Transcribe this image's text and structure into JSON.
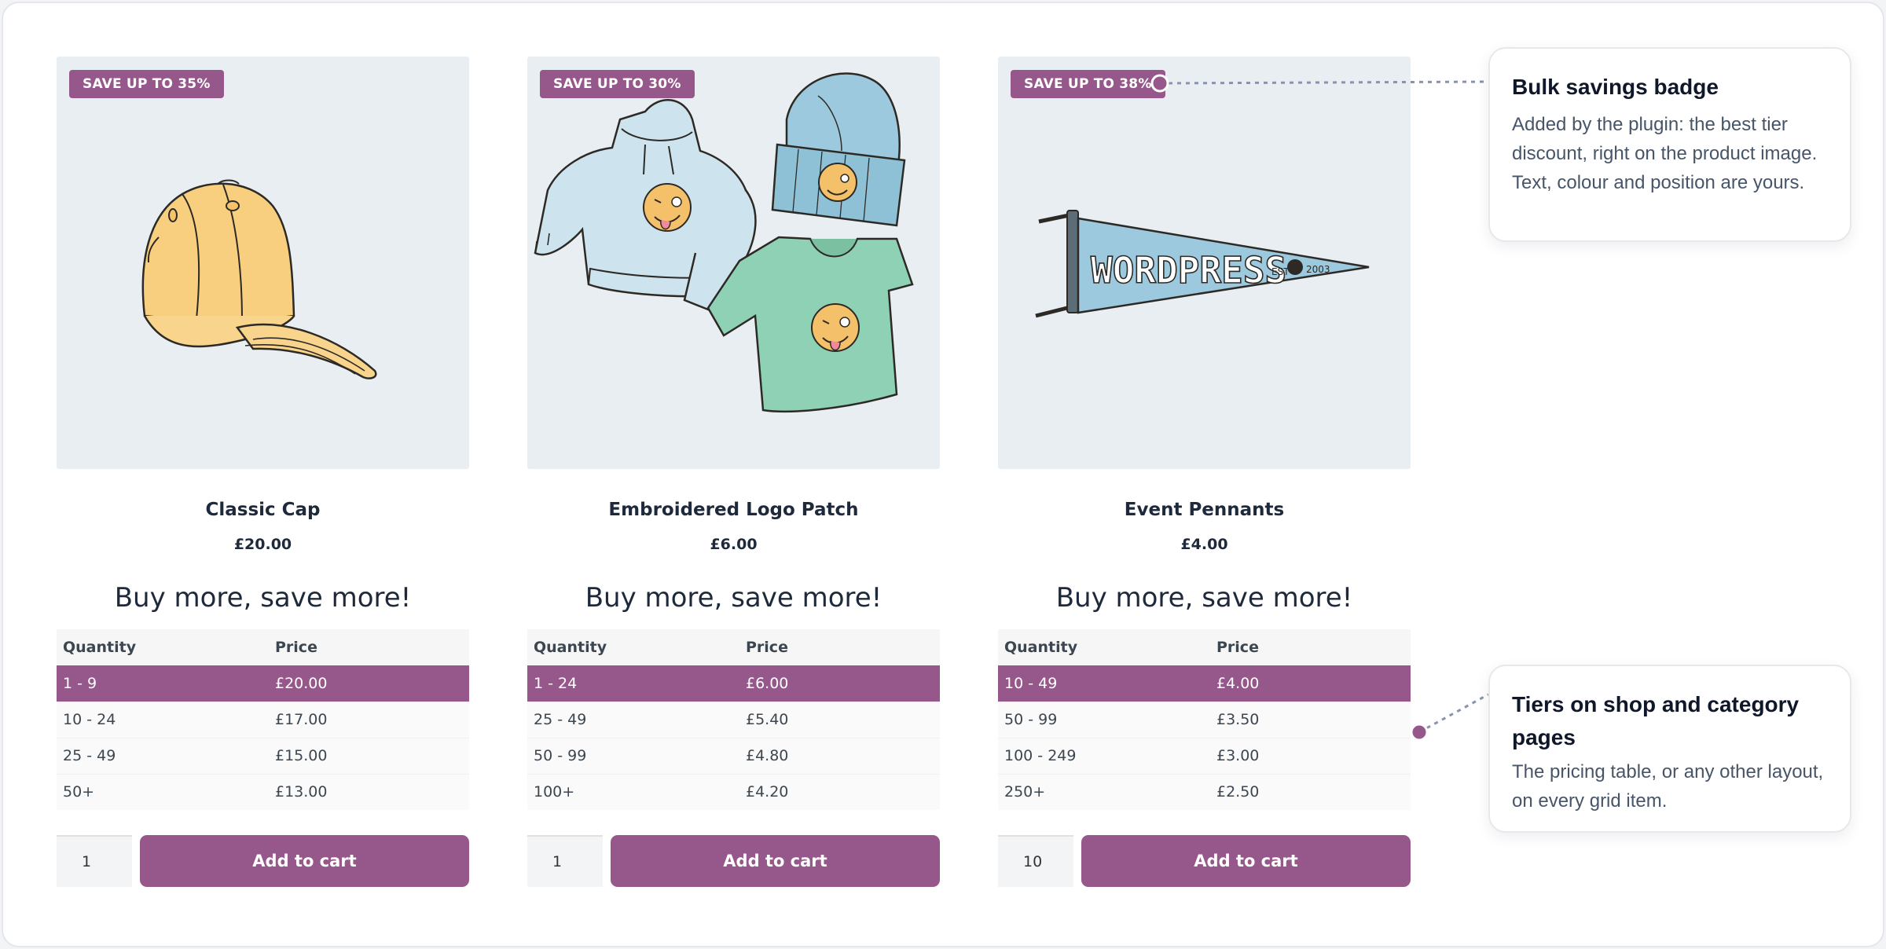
{
  "products": [
    {
      "badge": "SAVE UP TO 35%",
      "name": "Classic Cap",
      "price": "£20.00",
      "tier_heading": "Buy more, save more!",
      "table_headers": [
        "Quantity",
        "Price"
      ],
      "tiers": [
        {
          "qty": "1 - 9",
          "price": "£20.00",
          "active": true
        },
        {
          "qty": "10 - 24",
          "price": "£17.00"
        },
        {
          "qty": "25 - 49",
          "price": "£15.00"
        },
        {
          "qty": "50+",
          "price": "£13.00"
        }
      ],
      "quantity": "1",
      "add_to_cart": "Add to cart"
    },
    {
      "badge": "SAVE UP TO 30%",
      "name": "Embroidered Logo Patch",
      "price": "£6.00",
      "tier_heading": "Buy more, save more!",
      "table_headers": [
        "Quantity",
        "Price"
      ],
      "tiers": [
        {
          "qty": "1 - 24",
          "price": "£6.00",
          "active": true
        },
        {
          "qty": "25 - 49",
          "price": "£5.40"
        },
        {
          "qty": "50 - 99",
          "price": "£4.80"
        },
        {
          "qty": "100+",
          "price": "£4.20"
        }
      ],
      "quantity": "1",
      "add_to_cart": "Add to cart"
    },
    {
      "badge": "SAVE UP TO 38%",
      "name": "Event Pennants",
      "price": "£4.00",
      "tier_heading": "Buy more, save more!",
      "table_headers": [
        "Quantity",
        "Price"
      ],
      "tiers": [
        {
          "qty": "10 - 49",
          "price": "£4.00",
          "active": true
        },
        {
          "qty": "50 - 99",
          "price": "£3.50"
        },
        {
          "qty": "100 - 249",
          "price": "£3.00"
        },
        {
          "qty": "250+",
          "price": "£2.50"
        }
      ],
      "quantity": "10",
      "add_to_cart": "Add to cart"
    }
  ],
  "pennant_text": "WORDPRESS",
  "pennant_est": "EST",
  "pennant_year": "2003",
  "callouts": [
    {
      "title": "Bulk savings badge",
      "body": "Added by the plugin: the best tier discount, right on the product image. Text, colour and position are yours."
    },
    {
      "title": "Tiers on shop and category pages",
      "body": "The pricing table, or any other layout, on every grid item."
    }
  ],
  "colors": {
    "accent": "#96588a",
    "connector": "#8a93ad",
    "image_bg": "#e9eef2"
  },
  "icons": [
    "cap-illustration",
    "merch-illustration",
    "pennant-illustration"
  ]
}
